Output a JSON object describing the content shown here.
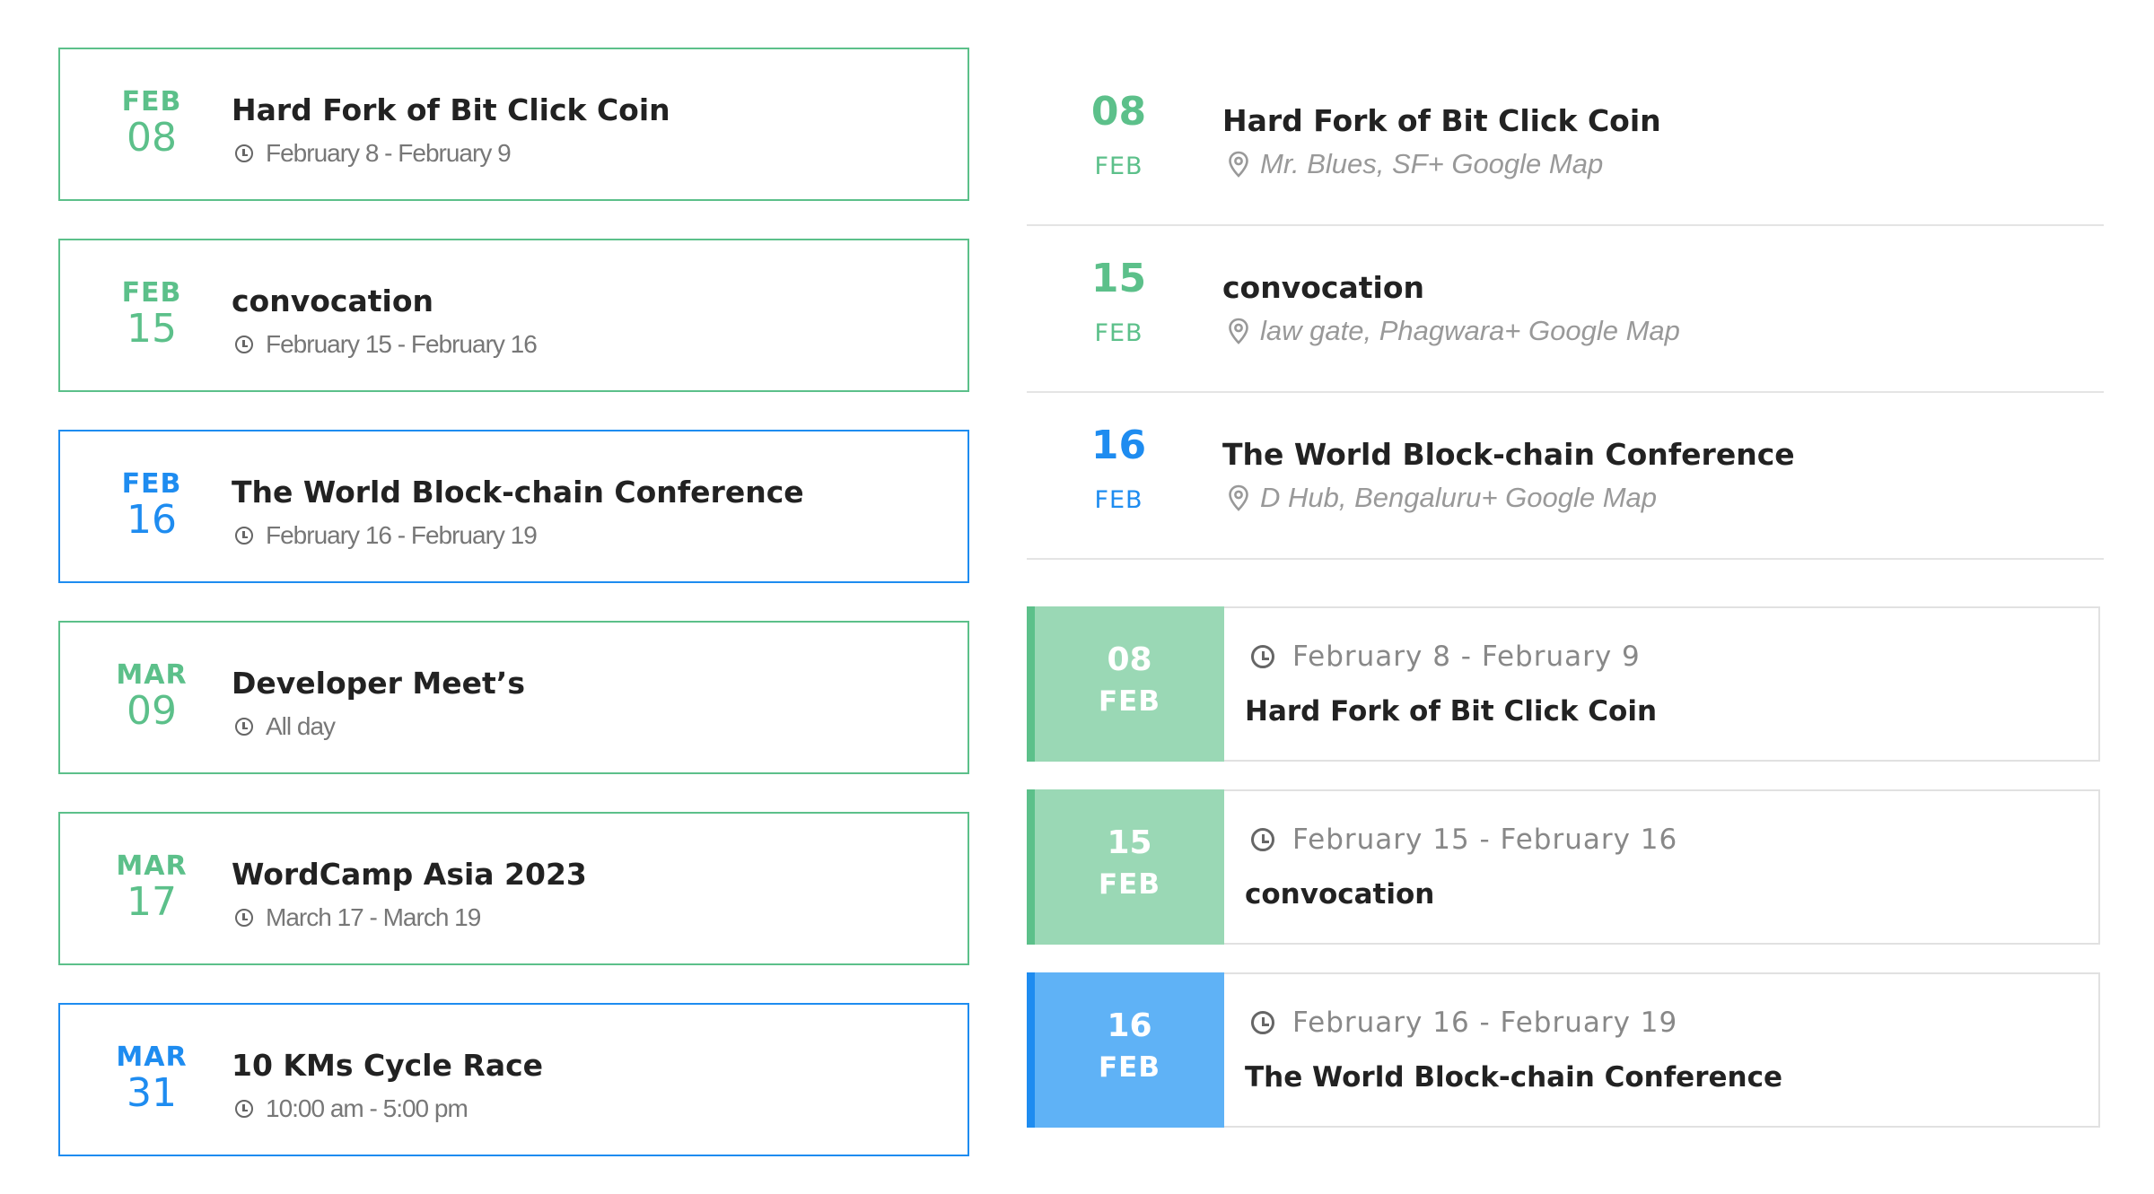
{
  "colors": {
    "green": "#5cc08a",
    "green_light": "#9ad8b5",
    "blue": "#1e8cf0",
    "blue_light": "#5fb2f6"
  },
  "left_cards": [
    {
      "month": "FEB",
      "day": "08",
      "title": "Hard Fork of Bit Click Coin",
      "meta": "February 8 - February 9",
      "color": "green"
    },
    {
      "month": "FEB",
      "day": "15",
      "title": "convocation",
      "meta": "February 15 - February 16",
      "color": "green"
    },
    {
      "month": "FEB",
      "day": "16",
      "title": "The World Block-chain Conference",
      "meta": "February 16 - February 19",
      "color": "blue"
    },
    {
      "month": "MAR",
      "day": "09",
      "title": "Developer Meet’s",
      "meta": "All day",
      "color": "green"
    },
    {
      "month": "MAR",
      "day": "17",
      "title": "WordCamp Asia 2023",
      "meta": "March 17 - March 19",
      "color": "green"
    },
    {
      "month": "MAR",
      "day": "31",
      "title": "10 KMs Cycle Race",
      "meta": "10:00 am - 5:00 pm",
      "color": "blue"
    }
  ],
  "list_items": [
    {
      "day": "08",
      "month": "FEB",
      "title": "Hard Fork of Bit Click Coin",
      "location": "Mr. Blues, SF",
      "map_link": "+ Google Map",
      "color": "green"
    },
    {
      "day": "15",
      "month": "FEB",
      "title": "convocation",
      "location": "law gate, Phagwara",
      "map_link": "+ Google Map",
      "color": "green"
    },
    {
      "day": "16",
      "month": "FEB",
      "title": "The World Block-chain Conference",
      "location": "D Hub, Bengaluru",
      "map_link": "+ Google Map",
      "color": "blue"
    }
  ],
  "block_cards": [
    {
      "day": "08",
      "month": "FEB",
      "dates": "February 8 - February 9",
      "title": "Hard Fork of Bit Click Coin",
      "color": "green"
    },
    {
      "day": "15",
      "month": "FEB",
      "dates": "February 15 - February 16",
      "title": "convocation",
      "color": "green"
    },
    {
      "day": "16",
      "month": "FEB",
      "dates": "February 16 - February 19",
      "title": "The World Block-chain Conference",
      "color": "blue"
    }
  ]
}
